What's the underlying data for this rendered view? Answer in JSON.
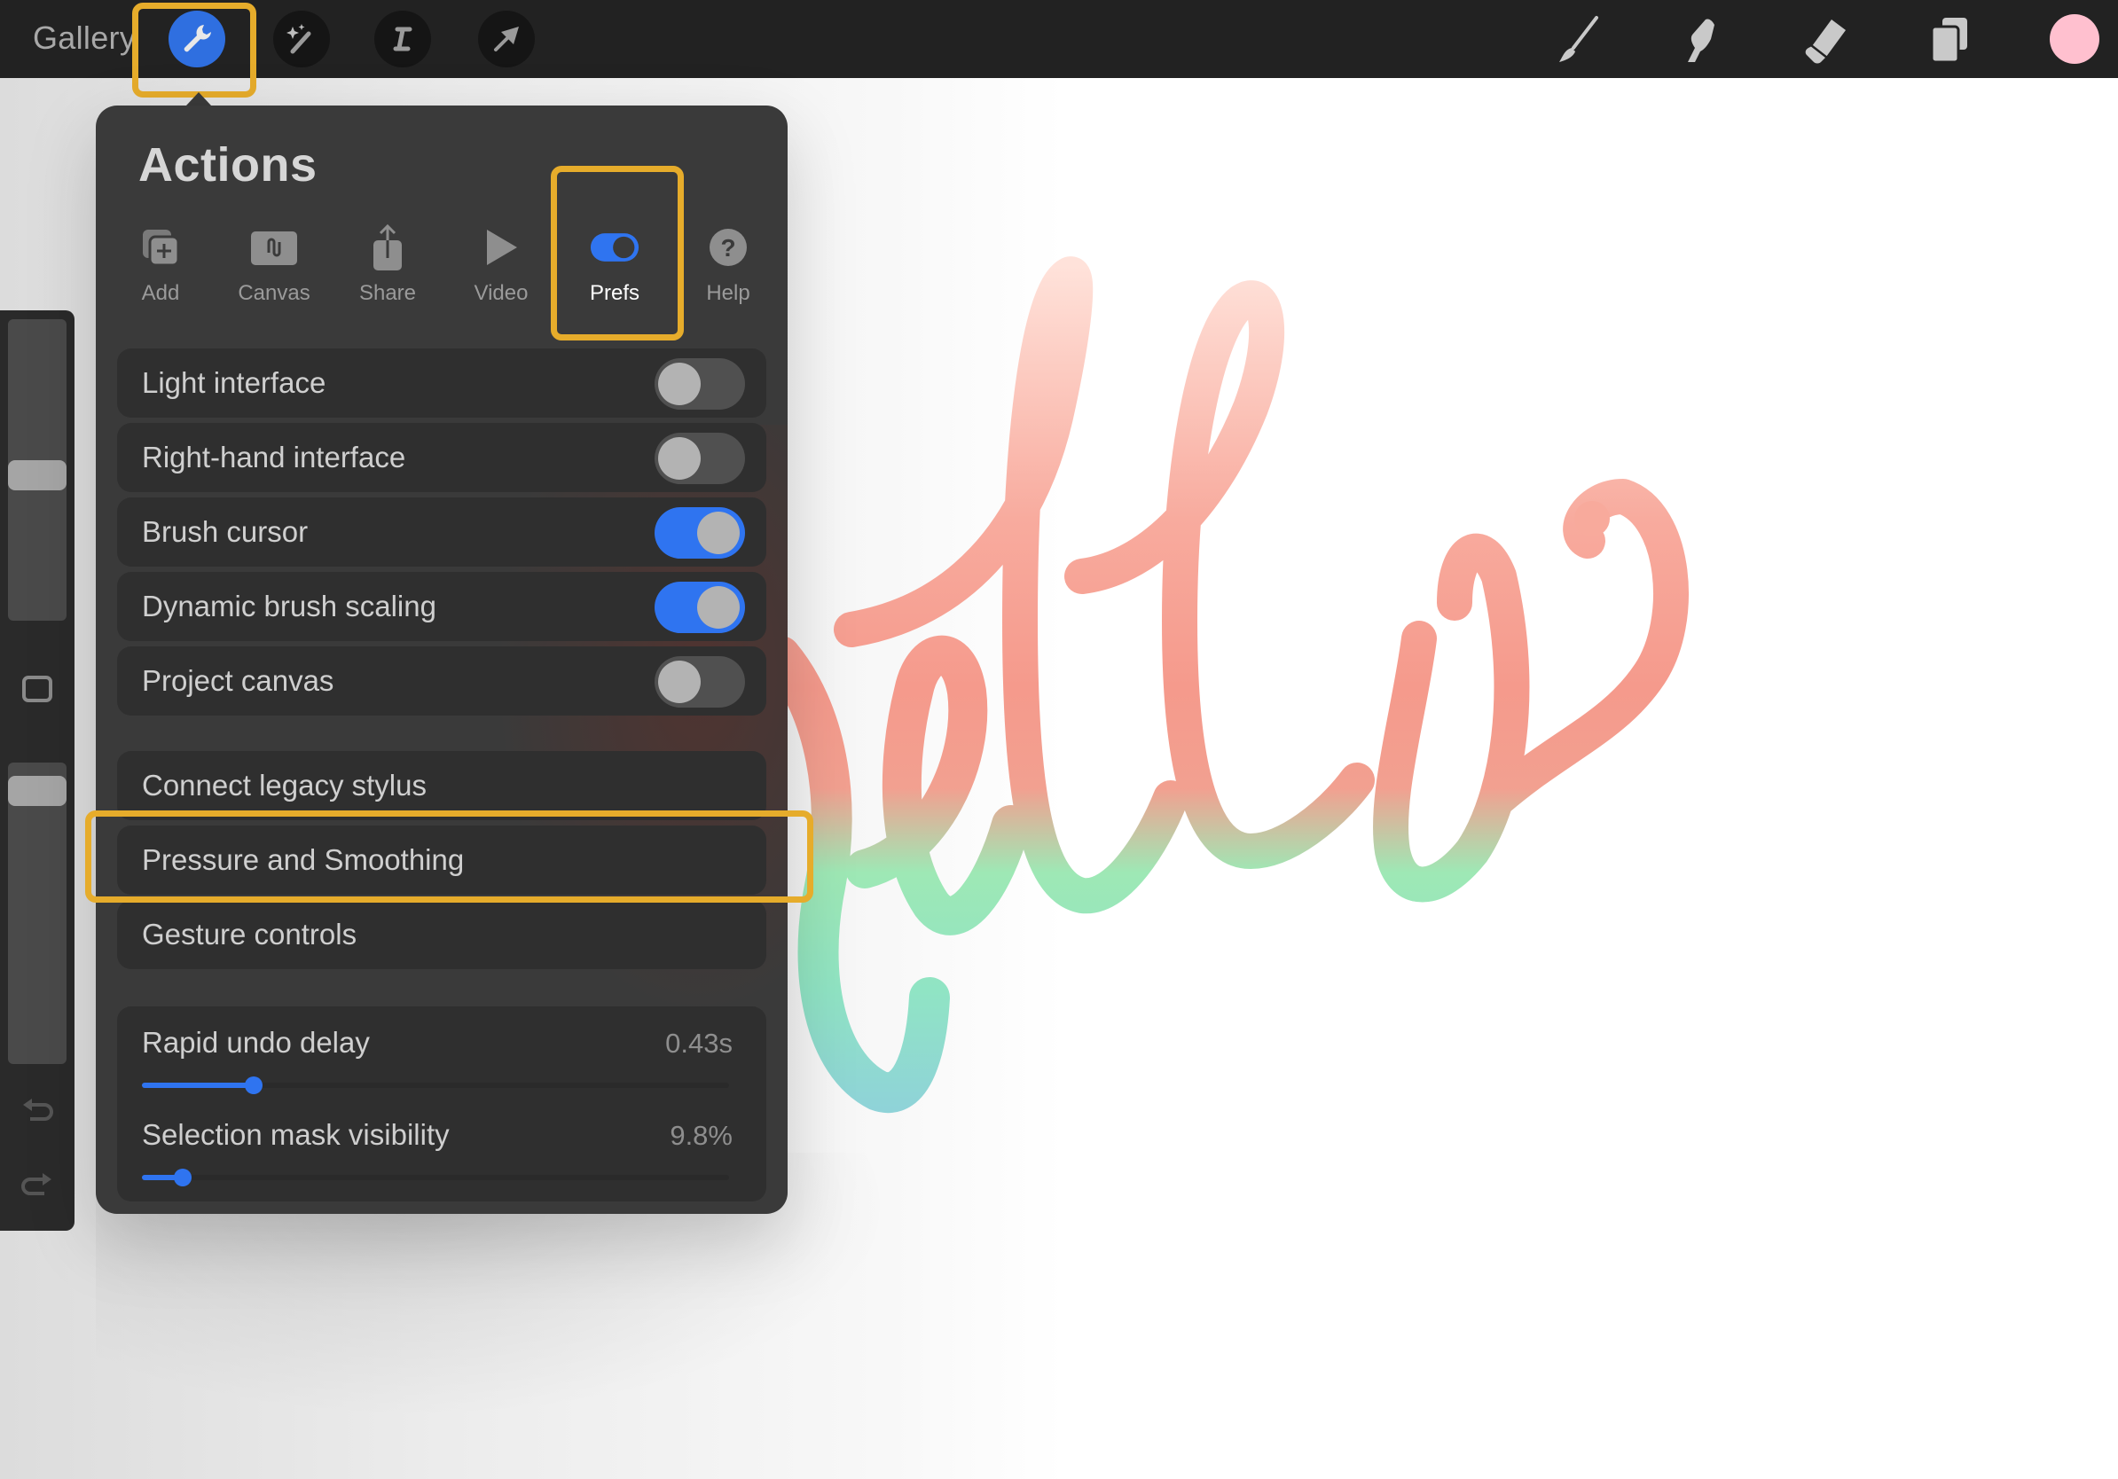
{
  "topbar": {
    "gallery_label": "Gallery",
    "left_tools": [
      {
        "name": "actions",
        "icon": "wrench-icon",
        "active": true
      },
      {
        "name": "adjustments",
        "icon": "magic-wand-icon",
        "active": false
      },
      {
        "name": "selection",
        "icon": "selection-s-icon",
        "active": false
      },
      {
        "name": "transform",
        "icon": "arrow-cursor-icon",
        "active": false
      }
    ],
    "right_tools": [
      {
        "name": "brush",
        "icon": "paintbrush-icon"
      },
      {
        "name": "smudge",
        "icon": "smudge-finger-icon"
      },
      {
        "name": "eraser",
        "icon": "eraser-icon"
      },
      {
        "name": "layers",
        "icon": "layers-icon"
      }
    ],
    "current_color": "#ffc0cf"
  },
  "sidebar": {
    "brush_size_level": 0.48,
    "opacity_level": 0.95,
    "modify_button_icon": "square-icon",
    "undo_icon": "undo-arrow-icon",
    "redo_icon": "redo-arrow-icon"
  },
  "actions_panel": {
    "title": "Actions",
    "tabs": [
      {
        "label": "Add",
        "icon": "add-icon",
        "active": false
      },
      {
        "label": "Canvas",
        "icon": "canvas-icon",
        "active": false
      },
      {
        "label": "Share",
        "icon": "share-icon",
        "active": false
      },
      {
        "label": "Video",
        "icon": "play-icon",
        "active": false
      },
      {
        "label": "Prefs",
        "icon": "toggle-icon",
        "active": true
      },
      {
        "label": "Help",
        "icon": "question-icon",
        "active": false
      }
    ],
    "toggles": [
      {
        "label": "Light interface",
        "on": false
      },
      {
        "label": "Right-hand interface",
        "on": false
      },
      {
        "label": "Brush cursor",
        "on": true
      },
      {
        "label": "Dynamic brush scaling",
        "on": true
      },
      {
        "label": "Project canvas",
        "on": false
      }
    ],
    "links": [
      {
        "label": "Connect legacy stylus"
      },
      {
        "label": "Pressure and Smoothing"
      },
      {
        "label": "Gesture controls"
      }
    ],
    "sliders": [
      {
        "label": "Rapid undo delay",
        "value_text": "0.43s",
        "fraction": 0.19
      },
      {
        "label": "Selection mask visibility",
        "value_text": "9.8%",
        "fraction": 0.07
      }
    ]
  },
  "colors": {
    "accent_blue": "#2f74f0",
    "highlight_yellow": "#e6ac2b",
    "lettering_top": "#f5958a",
    "lettering_mid": "#90ecb4",
    "lettering_bottom": "#8fd8d6"
  },
  "canvas": {
    "lettering_text": "hello"
  }
}
